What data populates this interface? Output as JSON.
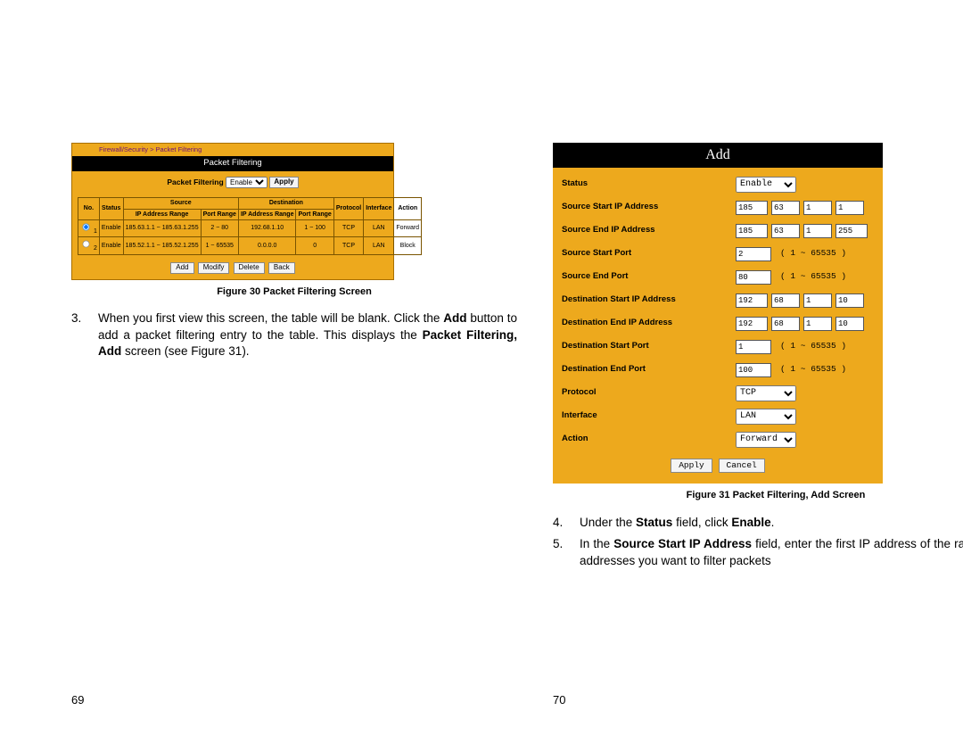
{
  "left_page": {
    "number": "69",
    "figure_caption": "Figure 30    Packet Filtering Screen",
    "step3_prefix": "3.",
    "step3_text_a": "When you first view this screen, the table will be blank. Click the ",
    "step3_bold_add": "Add",
    "step3_text_b": " button to add a packet filtering entry to the table.   This displays the ",
    "step3_bold_screen": "Packet Filtering, Add",
    "step3_text_c": " screen (see Figure 31).",
    "pf": {
      "breadcrumb": "Firewall/Security > Packet Filtering",
      "title_bar": "Packet Filtering",
      "filter_label": "Packet Filtering",
      "filter_select": "Enable",
      "apply": "Apply",
      "headers": {
        "no": "No.",
        "status": "Status",
        "source": "Source",
        "dest": "Destination",
        "ip_range": "IP Address Range",
        "port_range": "Port Range",
        "protocol": "Protocol",
        "interface": "Interface",
        "action": "Action"
      },
      "rows": [
        {
          "no": "1",
          "status": "Enable",
          "sip": "185.63.1.1 ~ 185.63.1.255",
          "sport": "2 ~ 80",
          "dip": "192.68.1.10",
          "dport": "1 ~ 100",
          "proto": "TCP",
          "iface": "LAN",
          "action": "Forward"
        },
        {
          "no": "2",
          "status": "Enable",
          "sip": "185.52.1.1 ~ 185.52.1.255",
          "sport": "1 ~ 65535",
          "dip": "0.0.0.0",
          "dport": "0",
          "proto": "TCP",
          "iface": "LAN",
          "action": "Block"
        }
      ],
      "buttons": {
        "add": "Add",
        "modify": "Modify",
        "delete": "Delete",
        "back": "Back"
      }
    }
  },
  "right_page": {
    "number": "70",
    "figure_caption": "Figure 31    Packet Filtering, Add Screen",
    "step4_prefix": "4.",
    "step4_a": "Under the ",
    "step4_b1": "Status",
    "step4_b": " field, click ",
    "step4_b2": "Enable",
    "step4_c": ".",
    "step5_prefix": "5.",
    "step5_a": "In the ",
    "step5_b1": "Source Start IP Address",
    "step5_b": " field, enter the first IP address of the range of addresses you want to filter packets",
    "add": {
      "title": "Add",
      "labels": {
        "status": "Status",
        "src_start_ip": "Source Start IP Address",
        "src_end_ip": "Source End IP Address",
        "src_start_port": "Source Start Port",
        "src_end_port": "Source End Port",
        "dst_start_ip": "Destination Start IP Address",
        "dst_end_ip": "Destination End IP Address",
        "dst_start_port": "Destination Start Port",
        "dst_end_port": "Destination End Port",
        "protocol": "Protocol",
        "interface": "Interface",
        "action": "Action"
      },
      "values": {
        "status": "Enable",
        "src_start_ip": [
          "185",
          "63",
          "1",
          "1"
        ],
        "src_end_ip": [
          "185",
          "63",
          "1",
          "255"
        ],
        "src_start_port": "2",
        "src_end_port": "80",
        "dst_start_ip": [
          "192",
          "68",
          "1",
          "10"
        ],
        "dst_end_ip": [
          "192",
          "68",
          "1",
          "10"
        ],
        "dst_start_port": "1",
        "dst_end_port": "100",
        "protocol": "TCP",
        "interface": "LAN",
        "action": "Forward"
      },
      "port_hint": "( 1 ~ 65535 )",
      "buttons": {
        "apply": "Apply",
        "cancel": "Cancel"
      }
    }
  }
}
